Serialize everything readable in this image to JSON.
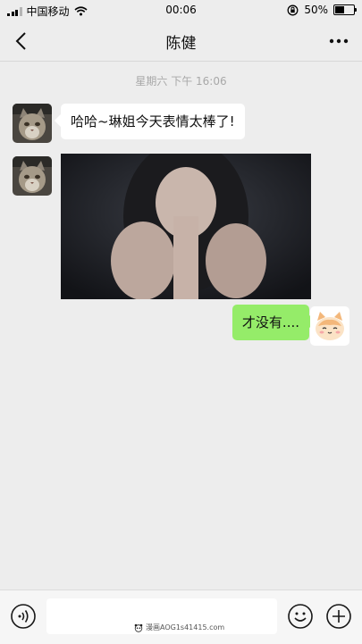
{
  "status_bar": {
    "carrier": "中国移动",
    "time": "00:06",
    "battery_text": "50%",
    "battery_level": 0.5
  },
  "nav": {
    "title": "陈健"
  },
  "chat": {
    "timestamp": "星期六 下午 16:06",
    "messages": [
      {
        "side": "left",
        "type": "text",
        "text": "哈哈~琳姐今天表情太棒了!"
      },
      {
        "side": "left",
        "type": "image"
      },
      {
        "side": "right",
        "type": "text",
        "text": "才没有...."
      }
    ]
  },
  "input_bar": {
    "input_value": ""
  },
  "watermark": "漫画AOG1s41415.com",
  "colors": {
    "background": "#ededed",
    "sent_bubble": "#95ec69",
    "received_bubble": "#ffffff"
  },
  "icons": {
    "back": "chevron-left-icon",
    "more": "more-dots-icon",
    "voice": "voice-icon",
    "emoji": "emoji-icon",
    "plus": "plus-icon"
  }
}
